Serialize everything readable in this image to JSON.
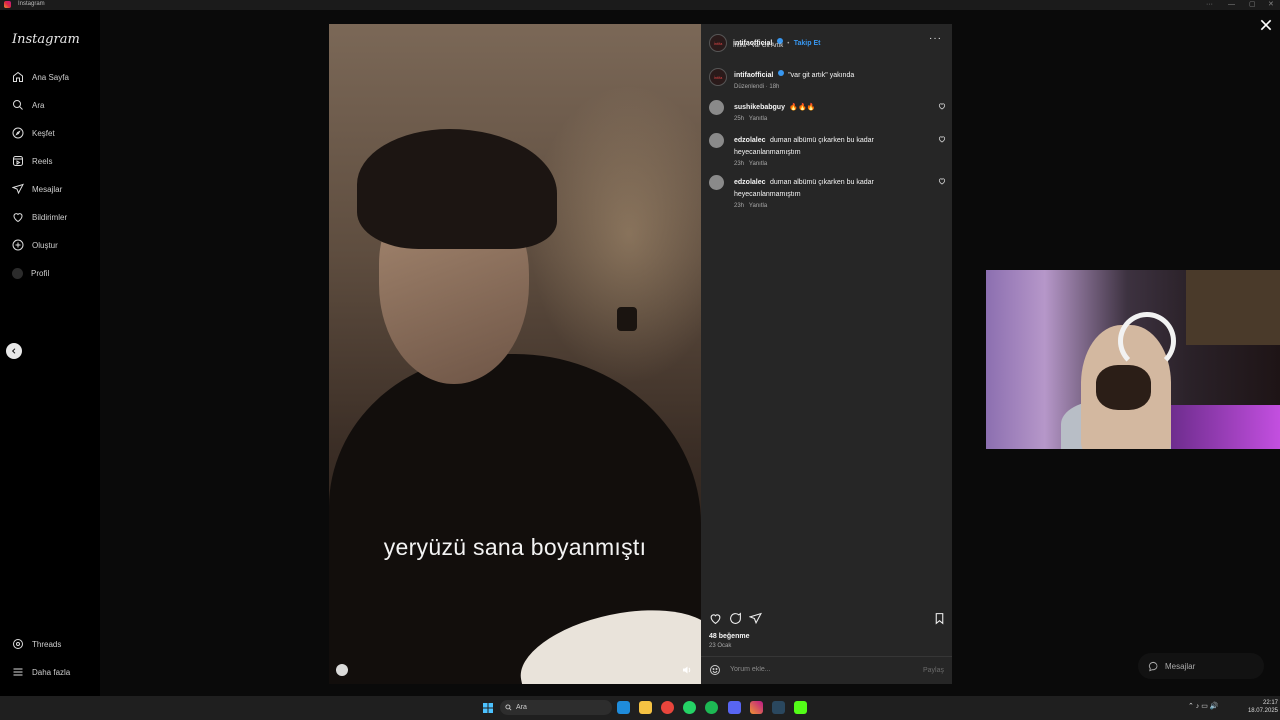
{
  "window": {
    "title": "Instagram"
  },
  "sidebar": {
    "logo": "Instagram",
    "items": [
      {
        "label": "Ana Sayfa",
        "icon": "home-icon"
      },
      {
        "label": "Ara",
        "icon": "search-icon"
      },
      {
        "label": "Keşfet",
        "icon": "compass-icon"
      },
      {
        "label": "Reels",
        "icon": "reels-icon"
      },
      {
        "label": "Mesajlar",
        "icon": "send-icon"
      },
      {
        "label": "Bildirimler",
        "icon": "heart-icon"
      },
      {
        "label": "Oluştur",
        "icon": "plus-icon"
      },
      {
        "label": "Profil",
        "icon": "avatar"
      }
    ],
    "bottom": [
      {
        "label": "Threads",
        "icon": "threads-icon"
      },
      {
        "label": "Daha fazla",
        "icon": "menu-icon"
      }
    ]
  },
  "video": {
    "caption": "yeryüzü sana boyanmıştı"
  },
  "post": {
    "username": "intifaofficial",
    "follow_label": "Takip Et",
    "separator": "•",
    "audio": "İntifa - Var Git Artık",
    "logo_text": "İntifa",
    "caption": {
      "username": "intifaofficial",
      "text": "\"var git artık\" yakında",
      "meta": "Düzenlendi · 18h"
    },
    "comments": [
      {
        "username": "sushikebabguy",
        "text": "🔥🔥🔥",
        "time": "25h",
        "reply": "Yanıtla"
      },
      {
        "username": "edzolalec",
        "text": "duman albümü çıkarken bu kadar heyecanlanmamıştım",
        "time": "23h",
        "reply": "Yanıtla"
      },
      {
        "username": "edzolalec",
        "text": "duman albümü çıkarken bu kadar heyecanlanmamıştım",
        "time": "23h",
        "reply": "Yanıtla"
      }
    ],
    "likes": "48 beğenme",
    "date": "23 Ocak",
    "comment_placeholder": "Yorum ekle...",
    "share_label": "Paylaş"
  },
  "messages_pill": {
    "label": "Mesajlar"
  },
  "taskbar": {
    "search_label": "Ara",
    "time": "22:17",
    "date": "18.07.2025"
  },
  "colors": {
    "accent": "#3897f0",
    "panel": "#262626",
    "background": "#000000"
  }
}
